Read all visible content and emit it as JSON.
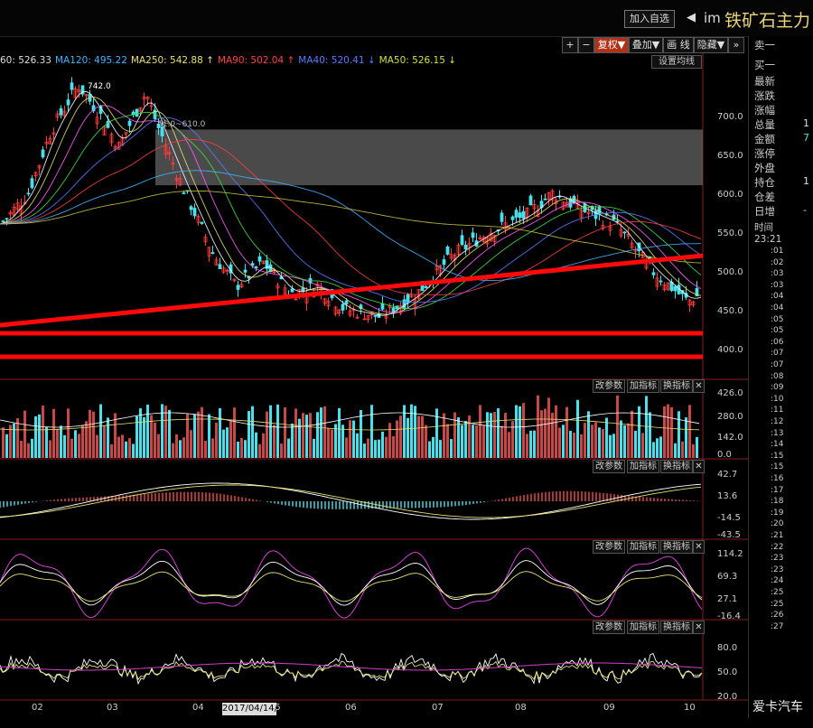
{
  "header": {
    "add_watch_label": "加入自选",
    "arrow": "◀",
    "code": "im",
    "name": "铁矿石主力"
  },
  "toolbar": {
    "plus": "+",
    "minus": "−",
    "restore": "复权▼",
    "overlay": "叠加▼",
    "drawing": "画 线",
    "hide": "隐藏▼",
    "more": "»",
    "expand": "⛶"
  },
  "ma_legend": [
    {
      "text": "60: 526.33",
      "color": "#dddddd"
    },
    {
      "text": "MA120: 495.22",
      "color": "#3fb5ff"
    },
    {
      "text": "MA250: 542.88 ↑",
      "color": "#e8e070"
    },
    {
      "text": "MA90: 502.04 ↑",
      "color": "#ff4040"
    },
    {
      "text": "MA40: 520.41 ↓",
      "color": "#5a7bff"
    },
    {
      "text": "MA50: 526.15 ↓",
      "color": "#d0e040"
    }
  ],
  "settings_label": "设置均线",
  "annotations": {
    "high_label": "742.0",
    "range_label": "51.0~610.0"
  },
  "price_axis": [
    "700.0",
    "650.0",
    "600.0",
    "550.0",
    "500.0",
    "450.0",
    "400.0"
  ],
  "volume_axis": [
    "426.0",
    "280.0",
    "142.0",
    "0.0"
  ],
  "macd_axis": [
    "42.7",
    "13.6",
    "-14.5",
    "-43.5"
  ],
  "kdj_axis": [
    "114.2",
    "69.3",
    "27.1",
    "-16.4"
  ],
  "rsi_axis": [
    "80.0",
    "50.0",
    "20.0"
  ],
  "panel_buttons": {
    "params": "改参数",
    "add": "加指标",
    "switch": "换指标",
    "close": "✕"
  },
  "months": [
    "02",
    "03",
    "04",
    "05",
    "06",
    "07",
    "08",
    "09",
    "10"
  ],
  "date_badge": "2017/04/14/五",
  "right_panel": {
    "quotes": [
      {
        "label": "卖一",
        "value": ""
      },
      {
        "label": "买一",
        "value": ""
      },
      {
        "label": "最新",
        "value": ""
      },
      {
        "label": "涨跌",
        "value": ""
      },
      {
        "label": "涨幅",
        "value": ""
      },
      {
        "label": "总量",
        "value": "1"
      },
      {
        "label": "金额",
        "value": "7"
      },
      {
        "label": "涨停",
        "value": ""
      },
      {
        "label": "外盘",
        "value": ""
      },
      {
        "label": "持仓",
        "value": "1"
      },
      {
        "label": "仓差",
        "value": ""
      },
      {
        "label": "日增",
        "value": "-"
      }
    ],
    "time_header": "时间",
    "time_first": "23:21",
    "times": [
      ":01",
      ":02",
      ":03",
      ":03",
      ":04",
      ":04",
      ":05",
      ":05",
      ":06",
      ":07",
      ":07",
      ":08",
      ":09",
      ":10",
      ":11",
      ":12",
      ":13",
      ":14",
      ":15",
      ":15",
      ":16",
      ":17",
      ":18",
      ":19",
      ":20",
      ":21",
      ":22",
      ":23",
      ":23",
      ":24",
      ":25",
      ":25",
      ":26",
      ":27"
    ]
  },
  "watermark": "爱卡汽车"
}
